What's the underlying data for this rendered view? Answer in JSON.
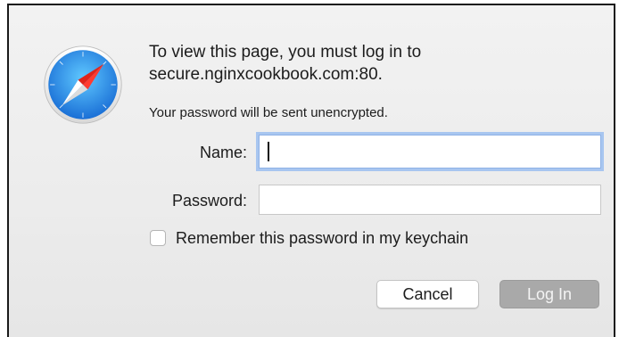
{
  "dialog": {
    "title_line1": "To view this page, you must log in to",
    "title_line2": "secure.nginxcookbook.com:80.",
    "subtitle": "Your password will be sent unencrypted.",
    "icon": "safari-compass-icon"
  },
  "form": {
    "name_label": "Name:",
    "name_value": "",
    "password_label": "Password:",
    "password_value": "",
    "remember_label": "Remember this password in my keychain",
    "remember_checked": false
  },
  "buttons": {
    "cancel": "Cancel",
    "login": "Log In"
  },
  "colors": {
    "focus_ring": "#a8c6f0",
    "login_disabled": "#a9a9a9"
  }
}
